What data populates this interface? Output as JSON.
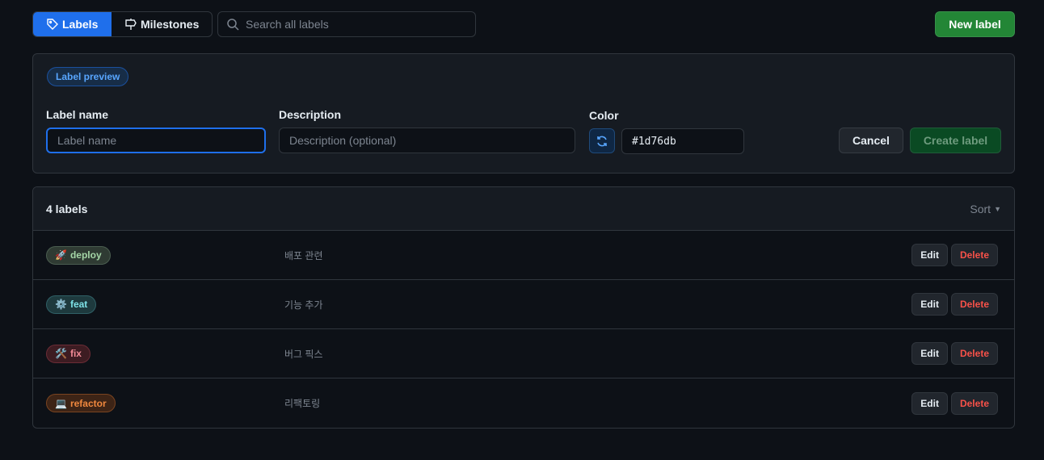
{
  "nav": {
    "labels": "Labels",
    "milestones": "Milestones"
  },
  "search": {
    "placeholder": "Search all labels"
  },
  "new_label": "New label",
  "form": {
    "preview": "Label preview",
    "name_label": "Label name",
    "name_placeholder": "Label name",
    "desc_label": "Description",
    "desc_placeholder": "Description (optional)",
    "color_label": "Color",
    "color_value": "#1d76db",
    "cancel": "Cancel",
    "create": "Create label"
  },
  "list": {
    "count": "4 labels",
    "sort": "Sort",
    "edit": "Edit",
    "delete": "Delete",
    "labels": [
      {
        "emoji": "🚀",
        "name": "deploy",
        "desc": "배포 관련",
        "fg": "#a5d6a7",
        "bg": "#2f3b33",
        "border": "#4b5e50"
      },
      {
        "emoji": "⚙️",
        "name": "feat",
        "desc": "기능 추가",
        "fg": "#7ee3e8",
        "bg": "#1e3a3e",
        "border": "#2f6066"
      },
      {
        "emoji": "🛠️",
        "name": "fix",
        "desc": "버그 픽스",
        "fg": "#f28b96",
        "bg": "#3d1c22",
        "border": "#6b2c36"
      },
      {
        "emoji": "💻",
        "name": "refactor",
        "desc": "리팩토링",
        "fg": "#f0883e",
        "bg": "#3d2416",
        "border": "#7a4420"
      }
    ]
  }
}
